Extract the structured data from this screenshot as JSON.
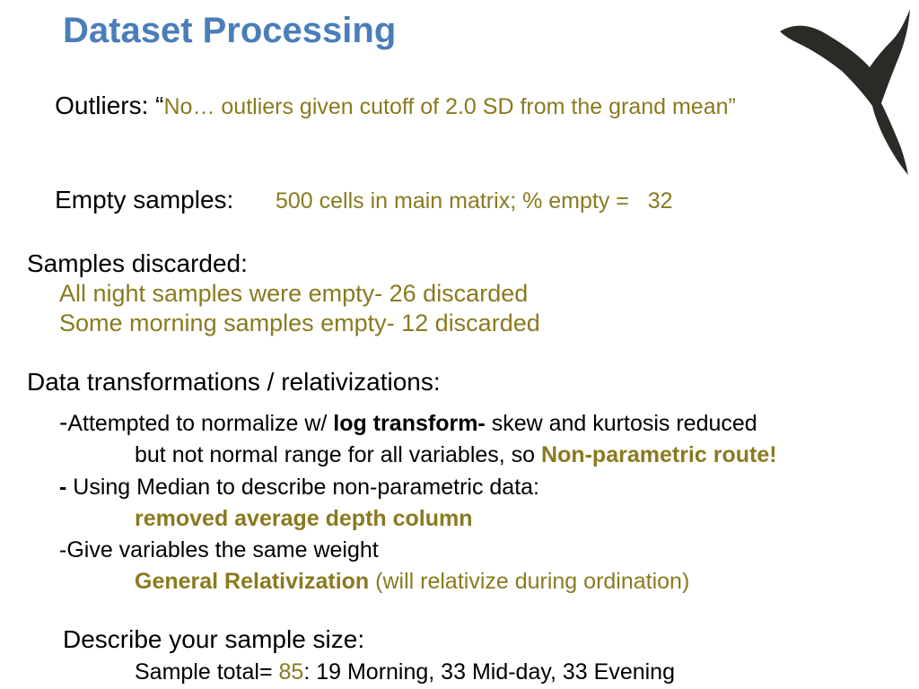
{
  "title": "Dataset Processing",
  "outliers": {
    "label": "Outliers: ",
    "quote_open": "“",
    "text": "No… outliers given cutoff of 2.0 SD from the grand mean”"
  },
  "empty_samples": {
    "label": "Empty samples:      ",
    "text": "500 cells in main matrix; % empty =   32"
  },
  "discarded": {
    "label": "Samples discarded:",
    "line1": "All night samples were empty- 26 discarded",
    "line2": "Some morning samples empty- 12 discarded"
  },
  "transforms": {
    "header": "Data transformations / relativizations:",
    "a_dash": "-",
    "a_pre": "Attempted to normalize w/ ",
    "a_bold": "log transform- ",
    "a_post": "skew and kurtosis reduced",
    "a_cont": "but not normal range for all variables, so ",
    "a_nonparam": "Non-parametric route!",
    "b_dash": "- ",
    "b_text": "Using Median to describe non-parametric data:",
    "b_result": "removed average depth column",
    "c_dash": "-",
    "c_text": "Give variables the same weight",
    "c_bold": "General Relativization ",
    "c_paren": "(will relativize during ordination)"
  },
  "sample_size": {
    "header": "Describe your sample size:",
    "pre": "Sample total= ",
    "total": "85",
    "post": ": 19 Morning, 33 Mid-day, 33 Evening"
  }
}
